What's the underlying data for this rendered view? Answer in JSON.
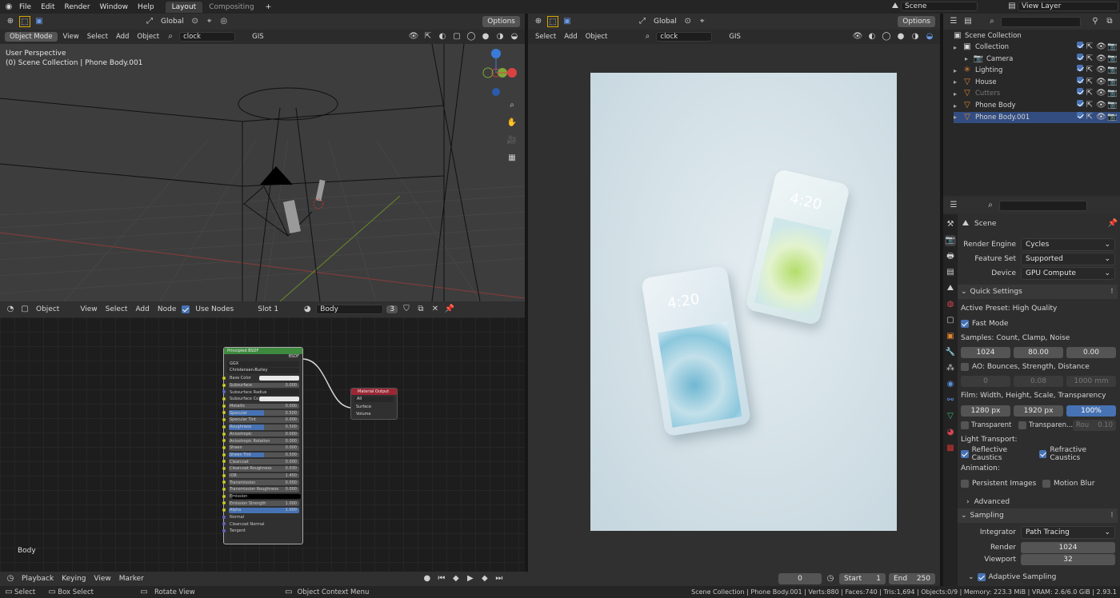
{
  "topbar": {
    "menus": [
      "File",
      "Edit",
      "Render",
      "Window",
      "Help"
    ],
    "workspaces": [
      "Layout",
      "Compositing"
    ],
    "scene": "Scene",
    "view_layer": "View Layer"
  },
  "viewport3d": {
    "mode": "Object Mode",
    "menus": [
      "View",
      "Select",
      "Add",
      "Object"
    ],
    "transform": "Global",
    "search": "clock",
    "gis": "GIS",
    "options": "Options",
    "overlay_line1": "User Perspective",
    "overlay_line2": "(0) Scene Collection | Phone Body.001"
  },
  "render_view": {
    "menus": [
      "Select",
      "Add",
      "Object"
    ],
    "transform": "Global",
    "search": "clock",
    "gis": "GIS",
    "options": "Options",
    "phone_time_1": "4:20",
    "phone_time_2": "4:20"
  },
  "node_editor": {
    "object": "Object",
    "menus": [
      "View",
      "Select",
      "Add",
      "Node"
    ],
    "use_nodes": "Use Nodes",
    "slot": "Slot 1",
    "material": "Body",
    "users": "3",
    "footer_label": "Body",
    "bsdf": {
      "title": "Principled BSDF",
      "out": "BSDF",
      "dist": "GGX",
      "sss": "Christensen-Burley",
      "rows": [
        [
          "Base Color",
          ""
        ],
        [
          "Subsurface",
          "0.000"
        ],
        [
          "Subsurface Radius",
          ""
        ],
        [
          "Subsurface Co",
          ""
        ],
        [
          "Metallic",
          "0.000"
        ],
        [
          "Specular",
          "0.500"
        ],
        [
          "Specular Tint",
          "0.000"
        ],
        [
          "Roughness",
          "0.500"
        ],
        [
          "Anisotropic",
          "0.000"
        ],
        [
          "Anisotropic Rotation",
          "0.000"
        ],
        [
          "Sheen",
          "0.000"
        ],
        [
          "Sheen Tint",
          "0.500"
        ],
        [
          "Clearcoat",
          "0.000"
        ],
        [
          "Clearcoat Roughness",
          "0.030"
        ],
        [
          "IOR",
          "1.450"
        ],
        [
          "Transmission",
          "0.000"
        ],
        [
          "Transmission Roughness",
          "0.000"
        ],
        [
          "Emission",
          ""
        ],
        [
          "Emission Strength",
          "1.000"
        ],
        [
          "Alpha",
          "1.000"
        ],
        [
          "Normal",
          ""
        ],
        [
          "Clearcoat Normal",
          ""
        ],
        [
          "Tangent",
          ""
        ]
      ]
    },
    "output": {
      "title": "Material Output",
      "target": "All",
      "surface": "Surface",
      "volume": "Volume"
    }
  },
  "timeline": {
    "menus": [
      "Playback",
      "Keying",
      "View",
      "Marker"
    ],
    "frame": "0",
    "start_label": "Start",
    "start": "1",
    "end_label": "End",
    "end": "250"
  },
  "statusbar": {
    "select": "Select",
    "box_select": "Box Select",
    "rotate": "Rotate View",
    "context": "Object Context Menu",
    "info": "Scene Collection | Phone Body.001 | Verts:880 | Faces:740 | Tris:1,694 | Objects:0/9 | Memory: 223.3 MiB | VRAM: 2.6/6.0 GiB | 2.93.1"
  },
  "outliner": {
    "root": "Scene Collection",
    "items": [
      {
        "label": "Collection",
        "muted": false
      },
      {
        "label": "Camera",
        "muted": false
      },
      {
        "label": "Lighting",
        "muted": false
      },
      {
        "label": "House",
        "muted": false
      },
      {
        "label": "Cutters",
        "muted": true
      },
      {
        "label": "Phone Body",
        "muted": false
      },
      {
        "label": "Phone Body.001",
        "muted": false
      }
    ]
  },
  "properties": {
    "context": "Scene",
    "render_engine_label": "Render Engine",
    "render_engine": "Cycles",
    "feature_set_label": "Feature Set",
    "feature_set": "Supported",
    "device_label": "Device",
    "device": "GPU Compute",
    "quick_settings": "Quick Settings",
    "active_preset": "Active Preset: High Quality",
    "fast_mode": "Fast Mode",
    "samples_label": "Samples: Count, Clamp, Noise",
    "samples": [
      "1024",
      "80.00",
      "0.00"
    ],
    "ao_label": "AO: Bounces, Strength, Distance",
    "ao": [
      "0",
      "0.08",
      "1000 mm"
    ],
    "film_label": "Film: Width, Height, Scale, Transparency",
    "film": [
      "1280 px",
      "1920 px",
      "100%"
    ],
    "transparent": "Transparent",
    "transparent2": "Transparen...",
    "rou": "Rou",
    "rou_val": "0.10",
    "light_transport": "Light Transport:",
    "reflective": "Reflective Caustics",
    "refractive": "Refractive Caustics",
    "animation": "Animation:",
    "persistent": "Persistent Images",
    "motion_blur": "Motion Blur",
    "advanced": "Advanced",
    "sampling": "Sampling",
    "integrator_label": "Integrator",
    "integrator": "Path Tracing",
    "render_label": "Render",
    "render_val": "1024",
    "viewport_label": "Viewport",
    "viewport_val": "32",
    "adaptive": "Adaptive Sampling"
  }
}
